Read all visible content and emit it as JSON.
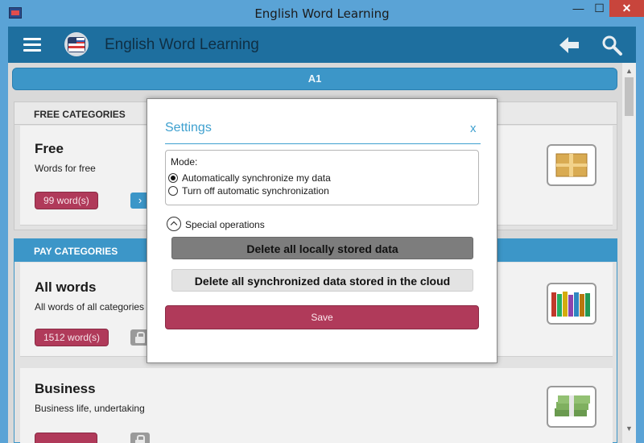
{
  "window": {
    "title": "English Word Learning",
    "minimize_glyph": "—",
    "maximize_glyph": "☐",
    "close_glyph": "✕"
  },
  "header": {
    "title": "English Word Learning",
    "icons": [
      "menu-icon",
      "app-logo-icon",
      "back-arrow-icon",
      "search-icon"
    ]
  },
  "level": {
    "label": "A1"
  },
  "sections": {
    "free": {
      "heading": "FREE CATEGORIES",
      "items": [
        {
          "name": "Free",
          "description": "Words for free",
          "word_count": "99 word(s)",
          "action_icon": "chevron-right-icon",
          "image_icon": "gift-box-icon"
        }
      ]
    },
    "pay": {
      "heading": "PAY CATEGORIES",
      "items": [
        {
          "name": "All words",
          "description": "All words of all categories",
          "word_count": "1512 word(s)",
          "action_icon": "lock-icon",
          "image_icon": "books-icon"
        },
        {
          "name": "Business",
          "description": "Business life, undertaking",
          "word_count": "",
          "action_icon": "lock-icon",
          "image_icon": "money-stack-icon"
        }
      ]
    }
  },
  "dialog": {
    "title": "Settings",
    "close_label": "x",
    "mode": {
      "label": "Mode:",
      "options": [
        {
          "label": "Automatically synchronize my data",
          "selected": true
        },
        {
          "label": "Turn off automatic synchronization",
          "selected": false
        }
      ]
    },
    "special": {
      "label": "Special operations",
      "delete_local": "Delete all locally stored data",
      "delete_cloud": "Delete all synchronized data stored in the cloud"
    },
    "save_label": "Save"
  },
  "colors": {
    "accent_blue": "#3c96c8",
    "header_blue": "#1e6f9f",
    "badge_crimson": "#b03a5a",
    "dialog_title": "#3ea0cf"
  }
}
